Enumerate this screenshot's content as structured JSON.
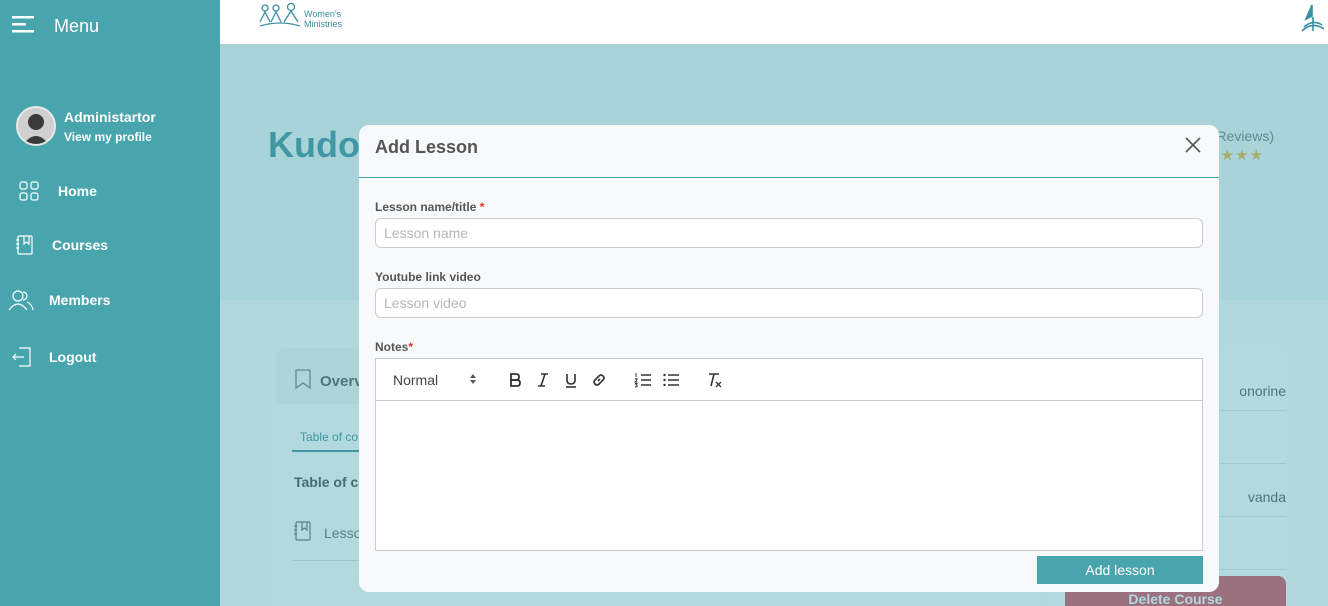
{
  "sidebar": {
    "menu_label": "Menu",
    "profile_name": "Administartor",
    "profile_link": "View my profile",
    "items": [
      {
        "label": "Home",
        "icon": "grid-icon"
      },
      {
        "label": "Courses",
        "icon": "book-icon"
      },
      {
        "label": "Members",
        "icon": "users-icon"
      },
      {
        "label": "Logout",
        "icon": "logout-icon"
      }
    ]
  },
  "header": {
    "logo_line1": "Women's",
    "logo_line2": "Ministries"
  },
  "background": {
    "hero_title": "Kudo",
    "reviews": "Reviews)",
    "stars": "★★★",
    "overview_tab": "Overv",
    "toc_tab": "Table of co",
    "toc_heading": "Table of co",
    "lesson_row": "Lesso",
    "side_items": [
      "onorine",
      "",
      "vanda"
    ],
    "delete_button": "Delete Course"
  },
  "modal": {
    "title": "Add Lesson",
    "lesson_name_label": "Lesson name/title",
    "lesson_name_placeholder": "Lesson name",
    "lesson_name_value": "",
    "youtube_label": "Youtube link video",
    "youtube_placeholder": "Lesson video",
    "youtube_value": "",
    "notes_label": "Notes",
    "required_mark": "*",
    "format_value": "Normal",
    "submit_label": "Add lesson"
  },
  "colors": {
    "sidebar_bg": "#48a4ad",
    "accent": "#48a4ad",
    "delete": "#d84a5e",
    "stars": "#e9b43a"
  }
}
